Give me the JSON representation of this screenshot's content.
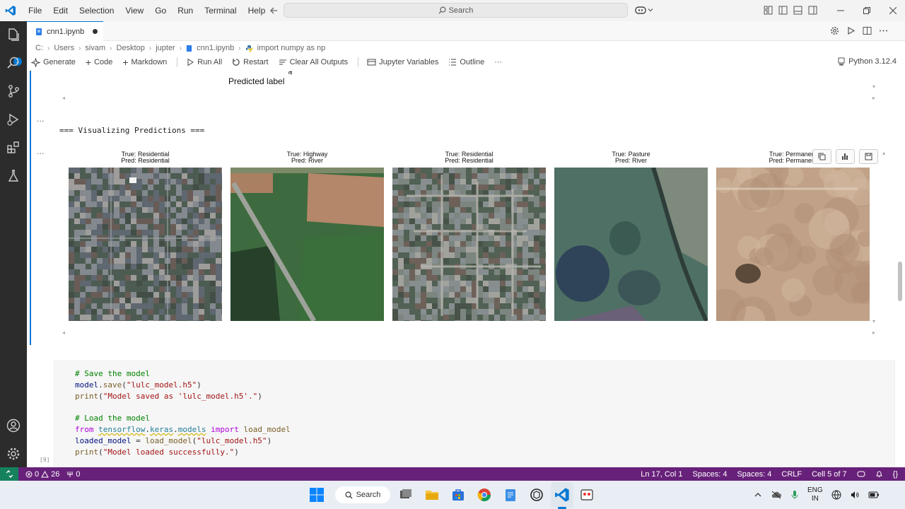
{
  "menu": [
    "File",
    "Edit",
    "Selection",
    "View",
    "Go",
    "Run",
    "Terminal",
    "Help"
  ],
  "search": {
    "label": "Search"
  },
  "tab": {
    "title": "cnn1.ipynb"
  },
  "breadcrumb": [
    "C:",
    "Users",
    "sivam",
    "Desktop",
    "jupter",
    "cnn1.ipynb",
    "import numpy as np"
  ],
  "toolbar": {
    "generate": "Generate",
    "code": "Code",
    "markdown": "Markdown",
    "run_all": "Run All",
    "restart": "Restart",
    "clear_outputs": "Clear All Outputs",
    "variables": "Jupyter Variables",
    "outline": "Outline",
    "more": "···",
    "kernel": "Python 3.12.4"
  },
  "output": {
    "predicted_label": "Predicted label",
    "tick_fragment": "a",
    "ellipsis": "...",
    "heading": "=== Visualizing Predictions ===",
    "predictions": [
      {
        "true": "True: Residential",
        "pred": "Pred: Residential",
        "kind": "residential"
      },
      {
        "true": "True: Highway",
        "pred": "Pred: River",
        "kind": "highway"
      },
      {
        "true": "True: Residential",
        "pred": "Pred: Residential",
        "kind": "residential2"
      },
      {
        "true": "True: Pasture",
        "pred": "Pred: River",
        "kind": "pasture"
      },
      {
        "true": "True: Permanent",
        "pred": "Pred: Permanent",
        "kind": "permanent"
      }
    ]
  },
  "code_cell": {
    "lines": [
      {
        "t": "# Save the model",
        "c": "com"
      },
      {
        "t": "model.save(\"lulc_model.h5\")",
        "c": "plain"
      },
      {
        "t": "print(\"Model saved as 'lulc_model.h5'.\")",
        "c": "plain"
      },
      {
        "t": "",
        "c": "plain"
      },
      {
        "t": "# Load the model",
        "c": "com"
      },
      {
        "t": "from tensorflow.keras.models import load_model",
        "c": "plain"
      },
      {
        "t": "loaded_model = load_model(\"lulc_model.h5\")",
        "c": "plain"
      },
      {
        "t": "print(\"Model loaded successfully.\")",
        "c": "plain"
      }
    ],
    "exec_count": "[9]"
  },
  "statusbar": {
    "errors": "0",
    "warnings": "26",
    "ports": "0",
    "position": "Ln 17, Col 1",
    "spaces1": "Spaces: 4",
    "spaces2": "Spaces: 4",
    "eol": "CRLF",
    "cell": "Cell 5 of 7"
  },
  "taskbar": {
    "search": "Search",
    "lang1": "ENG",
    "lang2": "IN"
  },
  "colors": {
    "accent": "#0078d4",
    "statusbar": "#68217a",
    "remote": "#16825d",
    "activity": "#2c2c2c"
  }
}
